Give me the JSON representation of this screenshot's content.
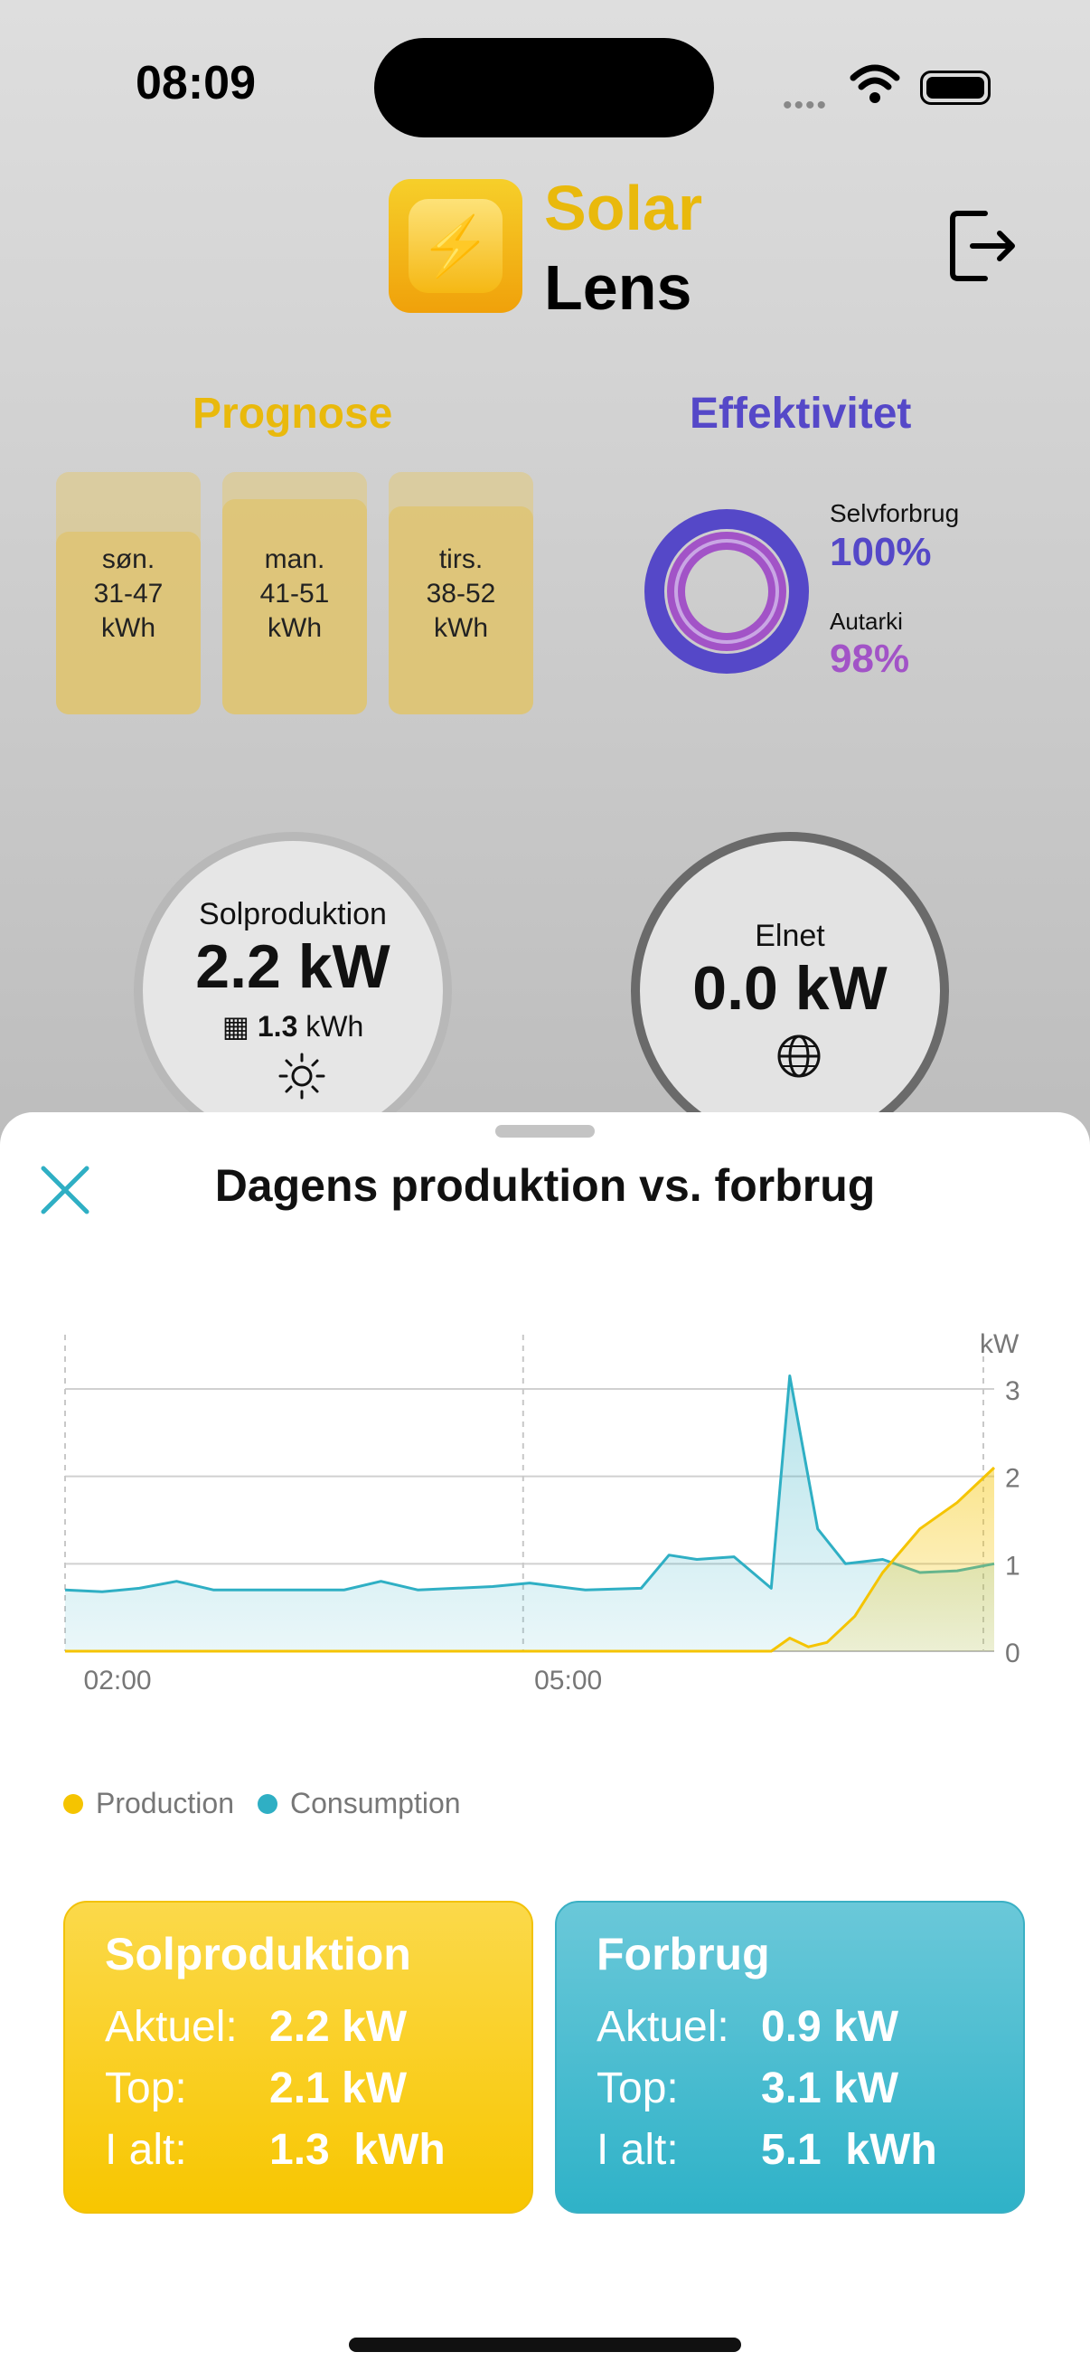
{
  "status": {
    "time": "08:09"
  },
  "app": {
    "name_line1": "Solar",
    "name_line2": "Lens"
  },
  "prognose": {
    "title": "Prognose",
    "days": [
      {
        "day": "søn.",
        "range": "31-47",
        "unit": "kWh"
      },
      {
        "day": "man.",
        "range": "41-51",
        "unit": "kWh"
      },
      {
        "day": "tirs.",
        "range": "38-52",
        "unit": "kWh"
      }
    ]
  },
  "efficiency": {
    "title": "Effektivitet",
    "self_label": "Selvforbrug",
    "self_value": "100%",
    "autarky_label": "Autarki",
    "autarky_value": "98%",
    "colors": {
      "self": "#5548c8",
      "autarky": "#a253c7"
    }
  },
  "solar_gauge": {
    "label": "Solproduktion",
    "value": "2.2 kW",
    "energy": "1.3",
    "energy_unit": "kWh",
    "icon": "sun-icon"
  },
  "grid_gauge": {
    "label": "Elnet",
    "value": "0.0 kW",
    "icon": "globe-icon"
  },
  "sheet": {
    "title": "Dagens produktion vs. forbrug"
  },
  "chart_data": {
    "type": "area",
    "y_unit": "kW",
    "ylim": [
      0,
      3
    ],
    "yticks": [
      "3",
      "2",
      "1",
      "0"
    ],
    "xticks": [
      "02:00",
      "05:00"
    ],
    "series": [
      {
        "name": "Production",
        "color": "#f5c400",
        "points": [
          [
            0,
            0
          ],
          [
            0.45,
            0
          ],
          [
            0.7,
            0
          ],
          [
            0.76,
            0
          ],
          [
            0.78,
            0.15
          ],
          [
            0.8,
            0.05
          ],
          [
            0.82,
            0.1
          ],
          [
            0.85,
            0.4
          ],
          [
            0.88,
            0.9
          ],
          [
            0.92,
            1.4
          ],
          [
            0.96,
            1.7
          ],
          [
            1,
            2.1
          ]
        ]
      },
      {
        "name": "Consumption",
        "color": "#2fafc4",
        "points": [
          [
            0,
            0.7
          ],
          [
            0.04,
            0.68
          ],
          [
            0.08,
            0.72
          ],
          [
            0.12,
            0.8
          ],
          [
            0.16,
            0.7
          ],
          [
            0.3,
            0.7
          ],
          [
            0.34,
            0.8
          ],
          [
            0.38,
            0.7
          ],
          [
            0.46,
            0.74
          ],
          [
            0.5,
            0.78
          ],
          [
            0.56,
            0.7
          ],
          [
            0.62,
            0.72
          ],
          [
            0.65,
            1.1
          ],
          [
            0.68,
            1.05
          ],
          [
            0.72,
            1.08
          ],
          [
            0.76,
            0.72
          ],
          [
            0.78,
            3.15
          ],
          [
            0.81,
            1.4
          ],
          [
            0.84,
            1.0
          ],
          [
            0.88,
            1.05
          ],
          [
            0.92,
            0.9
          ],
          [
            0.96,
            0.92
          ],
          [
            1,
            1.0
          ]
        ]
      }
    ]
  },
  "legend": {
    "production": "Production",
    "consumption": "Consumption"
  },
  "cards": {
    "solar": {
      "title": "Solproduktion",
      "now_label": "Aktuel:",
      "now": "2.2 kW",
      "peak_label": "Top:",
      "peak": "2.1 kW",
      "total_label": "I alt:",
      "total": "1.3  kWh"
    },
    "consumption": {
      "title": "Forbrug",
      "now_label": "Aktuel:",
      "now": "0.9 kW",
      "peak_label": "Top:",
      "peak": "3.1 kW",
      "total_label": "I alt:",
      "total": "5.1  kWh"
    }
  }
}
